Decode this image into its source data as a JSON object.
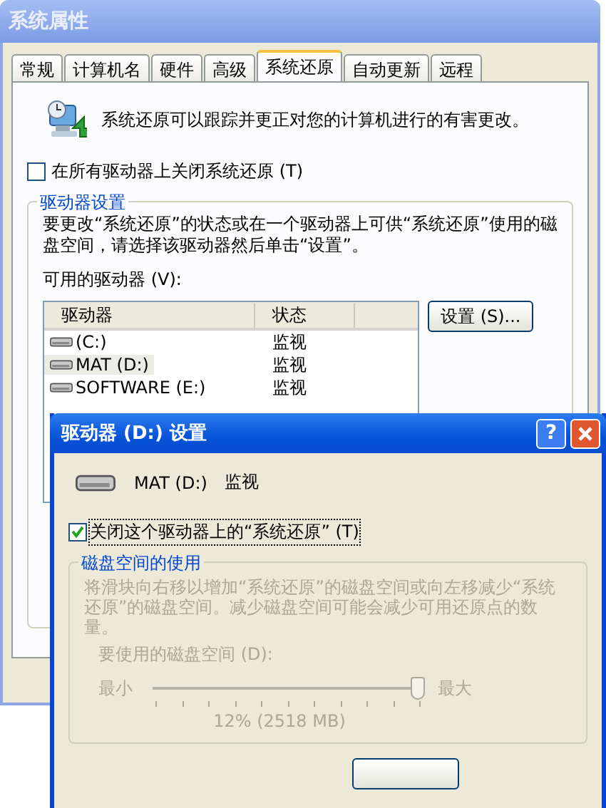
{
  "main_window": {
    "title": "系统属性",
    "tabs": [
      {
        "label": "常规",
        "selected": false
      },
      {
        "label": "计算机名",
        "selected": false
      },
      {
        "label": "硬件",
        "selected": false
      },
      {
        "label": "高级",
        "selected": false
      },
      {
        "label": "系统还原",
        "selected": true
      },
      {
        "label": "自动更新",
        "selected": false
      },
      {
        "label": "远程",
        "selected": false
      }
    ],
    "intro": "系统还原可以跟踪并更正对您的计算机进行的有害更改。",
    "turn_off_all": {
      "label": "在所有驱动器上关闭系统还原 (T)",
      "checked": false
    },
    "drive_settings": {
      "title": "驱动器设置",
      "description": "要更改“系统还原”的状态或在一个驱动器上可供“系统还原”使用的磁盘空间，请选择该驱动器然后单击“设置”。",
      "list_label": "可用的驱动器 (V):",
      "columns": [
        "驱动器",
        "状态"
      ],
      "rows": [
        {
          "drive": "(C:)",
          "status": "监视",
          "selected": false
        },
        {
          "drive": "MAT (D:)",
          "status": "监视",
          "selected": true
        },
        {
          "drive": "SOFTWARE (E:)",
          "status": "监视",
          "selected": false
        }
      ],
      "settings_button": "设置 (S)..."
    }
  },
  "dialog": {
    "title": "驱动器 (D:) 设置",
    "help_button": "?",
    "drive": "MAT (D:)",
    "status": "监视",
    "turn_off": {
      "label": "关闭这个驱动器上的“系统还原” (T)",
      "checked": true
    },
    "disk_usage": {
      "title": "磁盘空间的使用",
      "disabled": true,
      "description": "将滑块向右移以增加“系统还原”的磁盘空间或向左移减少“系统还原”的磁盘空间。减少磁盘空间可能会减少可用还原点的数量。",
      "slider_label": "要使用的磁盘空间 (D):",
      "min_label": "最小",
      "max_label": "最大",
      "level": 1,
      "reading": "12% (2518 MB)"
    }
  }
}
